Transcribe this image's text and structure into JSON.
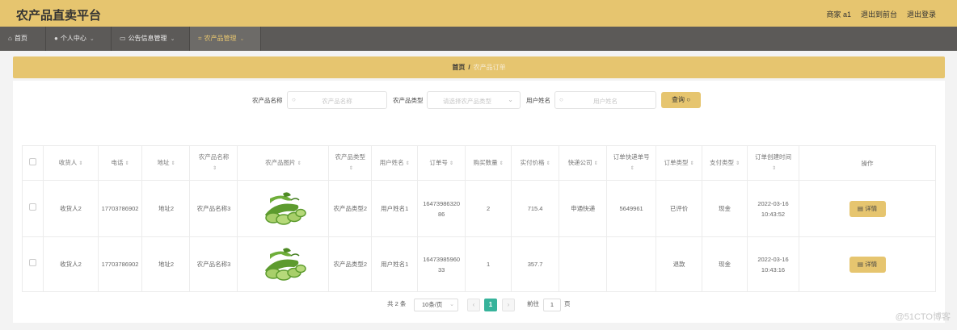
{
  "header": {
    "title": "农产品直卖平台",
    "user": "商家 a1",
    "back_link": "退出到前台",
    "logout_link": "退出登录"
  },
  "nav": {
    "home": "首页",
    "personal": "个人中心",
    "notice": "公告信息管理",
    "product": "农产品管理"
  },
  "breadcrumb": {
    "home": "首页",
    "separator": "/",
    "current": "农产品订单"
  },
  "search": {
    "name_label": "农产品名称",
    "name_placeholder": "农产品名称",
    "type_label": "农产品类型",
    "type_placeholder": "请选择农产品类型",
    "user_label": "用户姓名",
    "user_placeholder": "用户姓名",
    "query_button": "查询"
  },
  "table": {
    "headers": {
      "receiver": "收货人",
      "phone": "电话",
      "address": "地址",
      "product_name": "农产品名称",
      "product_image": "农产品图片",
      "product_type": "农产品类型",
      "user_name": "用户姓名",
      "order_no": "订单号",
      "quantity": "购买数量",
      "price": "实付价格",
      "courier": "快递公司",
      "tracking": "订单快递单号",
      "order_type": "订单类型",
      "pay_type": "支付类型",
      "created": "订单创建时间",
      "action": "操作"
    },
    "rows": [
      {
        "receiver": "收货人2",
        "phone": "17703786902",
        "address": "地址2",
        "product_name": "农产品名称3",
        "product_type": "农产品类型2",
        "user_name": "用户姓名1",
        "order_no": "1647398632086",
        "quantity": "2",
        "price": "715.4",
        "courier": "申通快递",
        "tracking": "5649961",
        "order_type": "已评价",
        "pay_type": "现金",
        "created": "2022-03-16 10:43:52",
        "detail": "详情"
      },
      {
        "receiver": "收货人2",
        "phone": "17703786902",
        "address": "地址2",
        "product_name": "农产品名称3",
        "product_type": "农产品类型2",
        "user_name": "用户姓名1",
        "order_no": "1647398596033",
        "quantity": "1",
        "price": "357.7",
        "courier": "",
        "tracking": "",
        "order_type": "退款",
        "pay_type": "现金",
        "created": "2022-03-16 10:43:16",
        "detail": "详情"
      }
    ]
  },
  "pagination": {
    "total": "共 2 条",
    "page_size": "10条/页",
    "current_page": "1",
    "goto_label": "前往",
    "goto_value": "1",
    "page_suffix": "页"
  },
  "watermark": "@51CTO博客",
  "colors": {
    "accent": "#e6c56f",
    "nav_bg": "#5c5a58",
    "page_active": "#37b39b"
  }
}
